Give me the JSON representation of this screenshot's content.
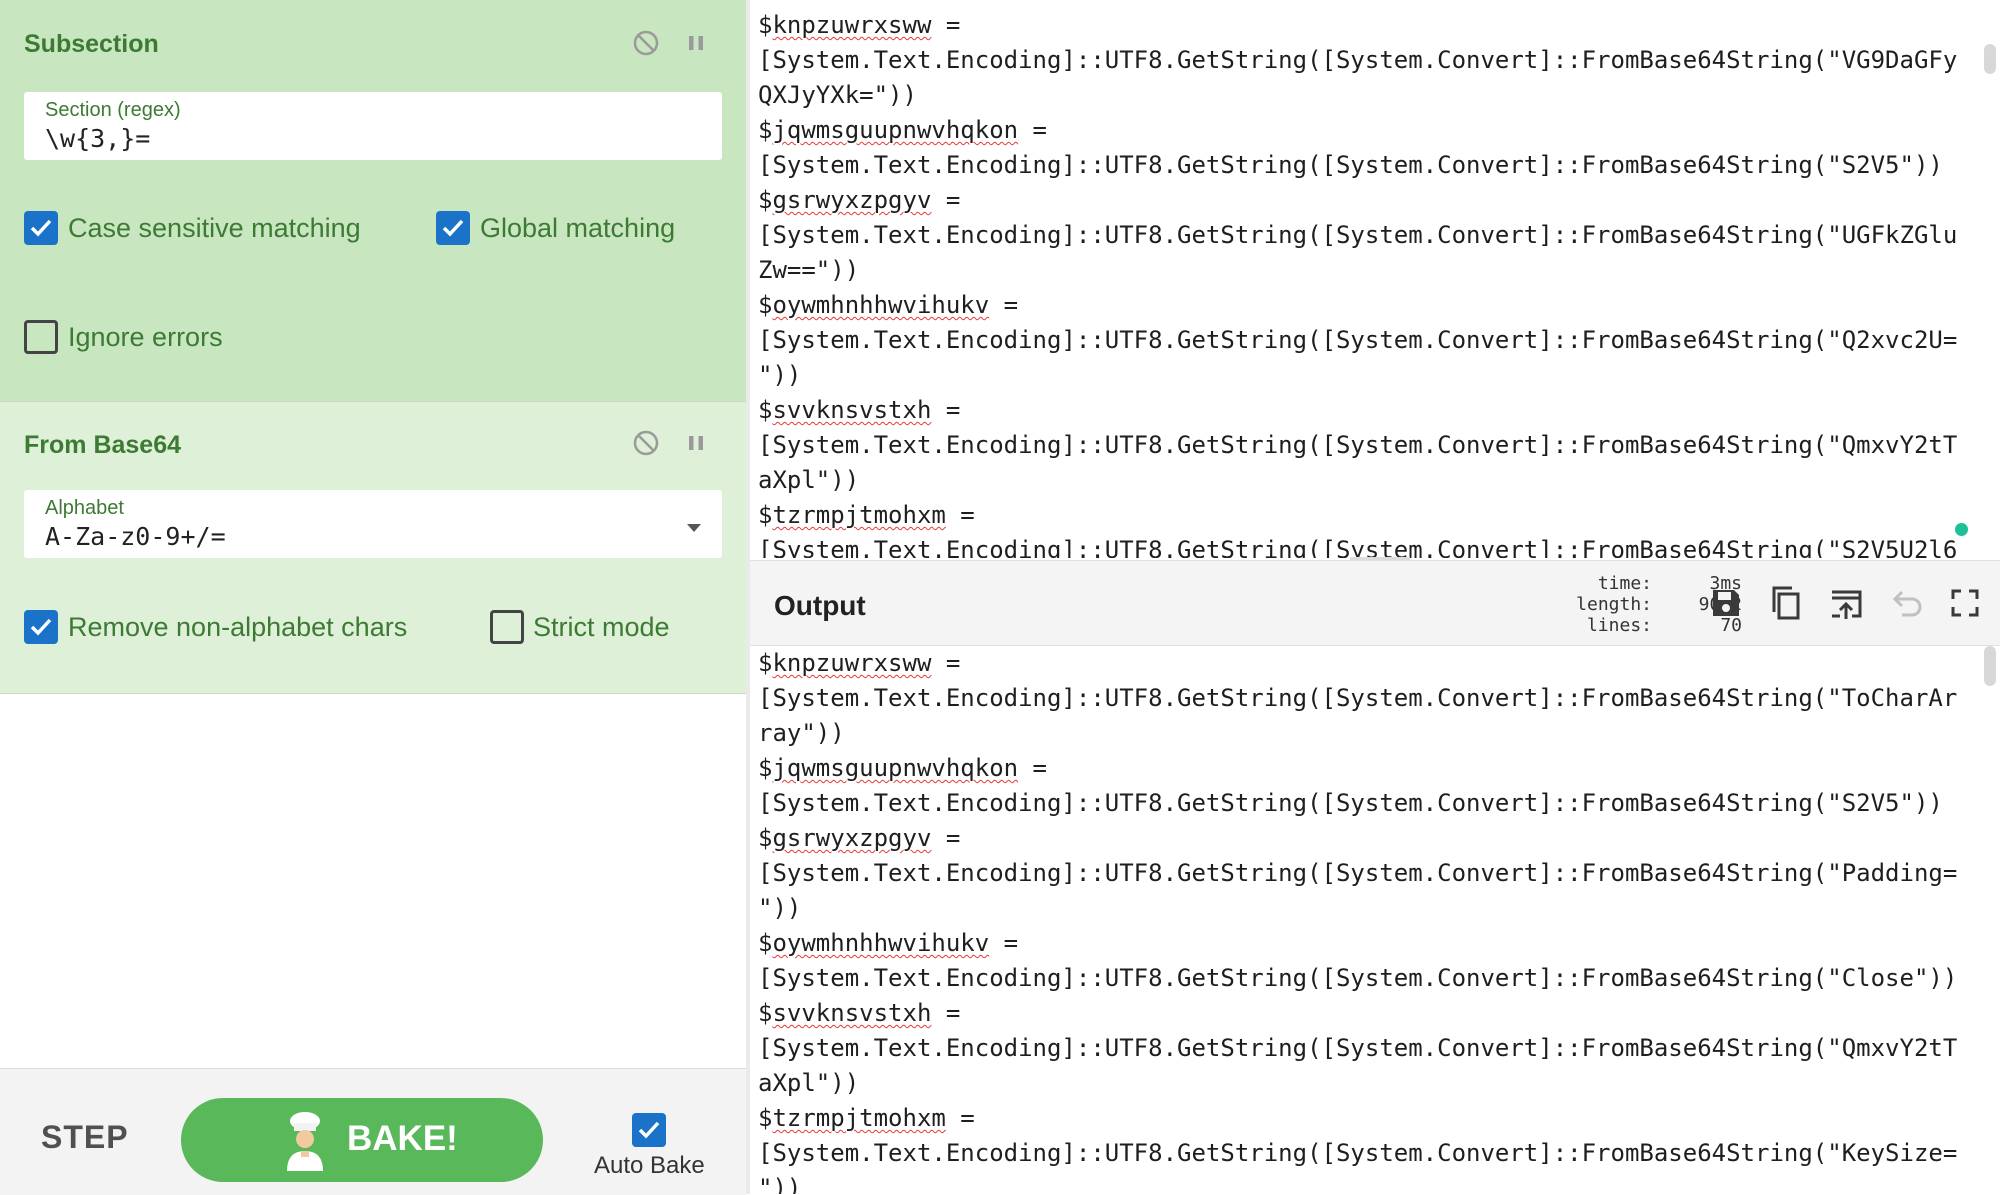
{
  "recipe": {
    "subsection": {
      "title": "Subsection",
      "section_label": "Section (regex)",
      "section_value": "\\w{3,}=",
      "case_sensitive": {
        "label": "Case sensitive matching",
        "checked": true
      },
      "global_matching": {
        "label": "Global matching",
        "checked": true
      },
      "ignore_errors": {
        "label": "Ignore errors",
        "checked": false
      },
      "icons": [
        "disable-icon",
        "pause-icon"
      ]
    },
    "from_base64": {
      "title": "From Base64",
      "alphabet_label": "Alphabet",
      "alphabet_value": "A-Za-z0-9+/=",
      "remove_non_alphabet": {
        "label": "Remove non-alphabet chars",
        "checked": true
      },
      "strict_mode": {
        "label": "Strict mode",
        "checked": false
      },
      "icons": [
        "disable-icon",
        "pause-icon"
      ]
    }
  },
  "controls": {
    "step_label": "STEP",
    "bake_label": "BAKE!",
    "auto_bake_label": "Auto Bake",
    "auto_bake_checked": true
  },
  "input_lines": [
    "$knpzuwrxsww =",
    "[System.Text.Encoding]::UTF8.GetString([System.Convert]::FromBase64String(\"VG9DaGFy",
    "QXJyYXk=\"))",
    "$jqwmsguupnwvhqkon =",
    "[System.Text.Encoding]::UTF8.GetString([System.Convert]::FromBase64String(\"S2V5\"))",
    "$gsrwyxzpgyv =",
    "[System.Text.Encoding]::UTF8.GetString([System.Convert]::FromBase64String(\"UGFkZGlu",
    "Zw==\"))",
    "$oywmhnhhwvihukv =",
    "[System.Text.Encoding]::UTF8.GetString([System.Convert]::FromBase64String(\"Q2xvc2U=",
    "\"))",
    "$svvknsvstxh =",
    "[System.Text.Encoding]::UTF8.GetString([System.Convert]::FromBase64String(\"QmxvY2tT",
    "aXpl\"))",
    "$tzrmpjtmohxm =",
    "[System.Text.Encoding]::UTF8.GetString([System.Convert]::FromBase64String(\"S2V5U2l6"
  ],
  "output": {
    "title": "Output",
    "stats": [
      {
        "key": "time:",
        "value": "3ms"
      },
      {
        "key": "length:",
        "value": "9002"
      },
      {
        "key": "lines:",
        "value": "70"
      }
    ],
    "tools": [
      "save-icon",
      "copy-icon",
      "replace-input-icon",
      "undo-icon",
      "maximise-icon"
    ],
    "lines": [
      "$knpzuwrxsww =",
      "[System.Text.Encoding]::UTF8.GetString([System.Convert]::FromBase64String(\"ToCharAr",
      "ray\"))",
      "$jqwmsguupnwvhqkon =",
      "[System.Text.Encoding]::UTF8.GetString([System.Convert]::FromBase64String(\"S2V5\"))",
      "$gsrwyxzpgyv =",
      "[System.Text.Encoding]::UTF8.GetString([System.Convert]::FromBase64String(\"Padding=",
      "\"))",
      "$oywmhnhhwvihukv =",
      "[System.Text.Encoding]::UTF8.GetString([System.Convert]::FromBase64String(\"Close\"))",
      "$svvknsvstxh =",
      "[System.Text.Encoding]::UTF8.GetString([System.Convert]::FromBase64String(\"QmxvY2tT",
      "aXpl\"))",
      "$tzrmpjtmohxm =",
      "[System.Text.Encoding]::UTF8.GetString([System.Convert]::FromBase64String(\"KeySize=",
      "\"))"
    ]
  },
  "colors": {
    "subsection_bg": "#c8e6c0",
    "from_base64_bg": "#dff0d8",
    "op_text": "#3d7a34",
    "checkbox_on": "#1a73c8",
    "bake_button": "#58b85a",
    "status_dot": "#1cc198"
  }
}
